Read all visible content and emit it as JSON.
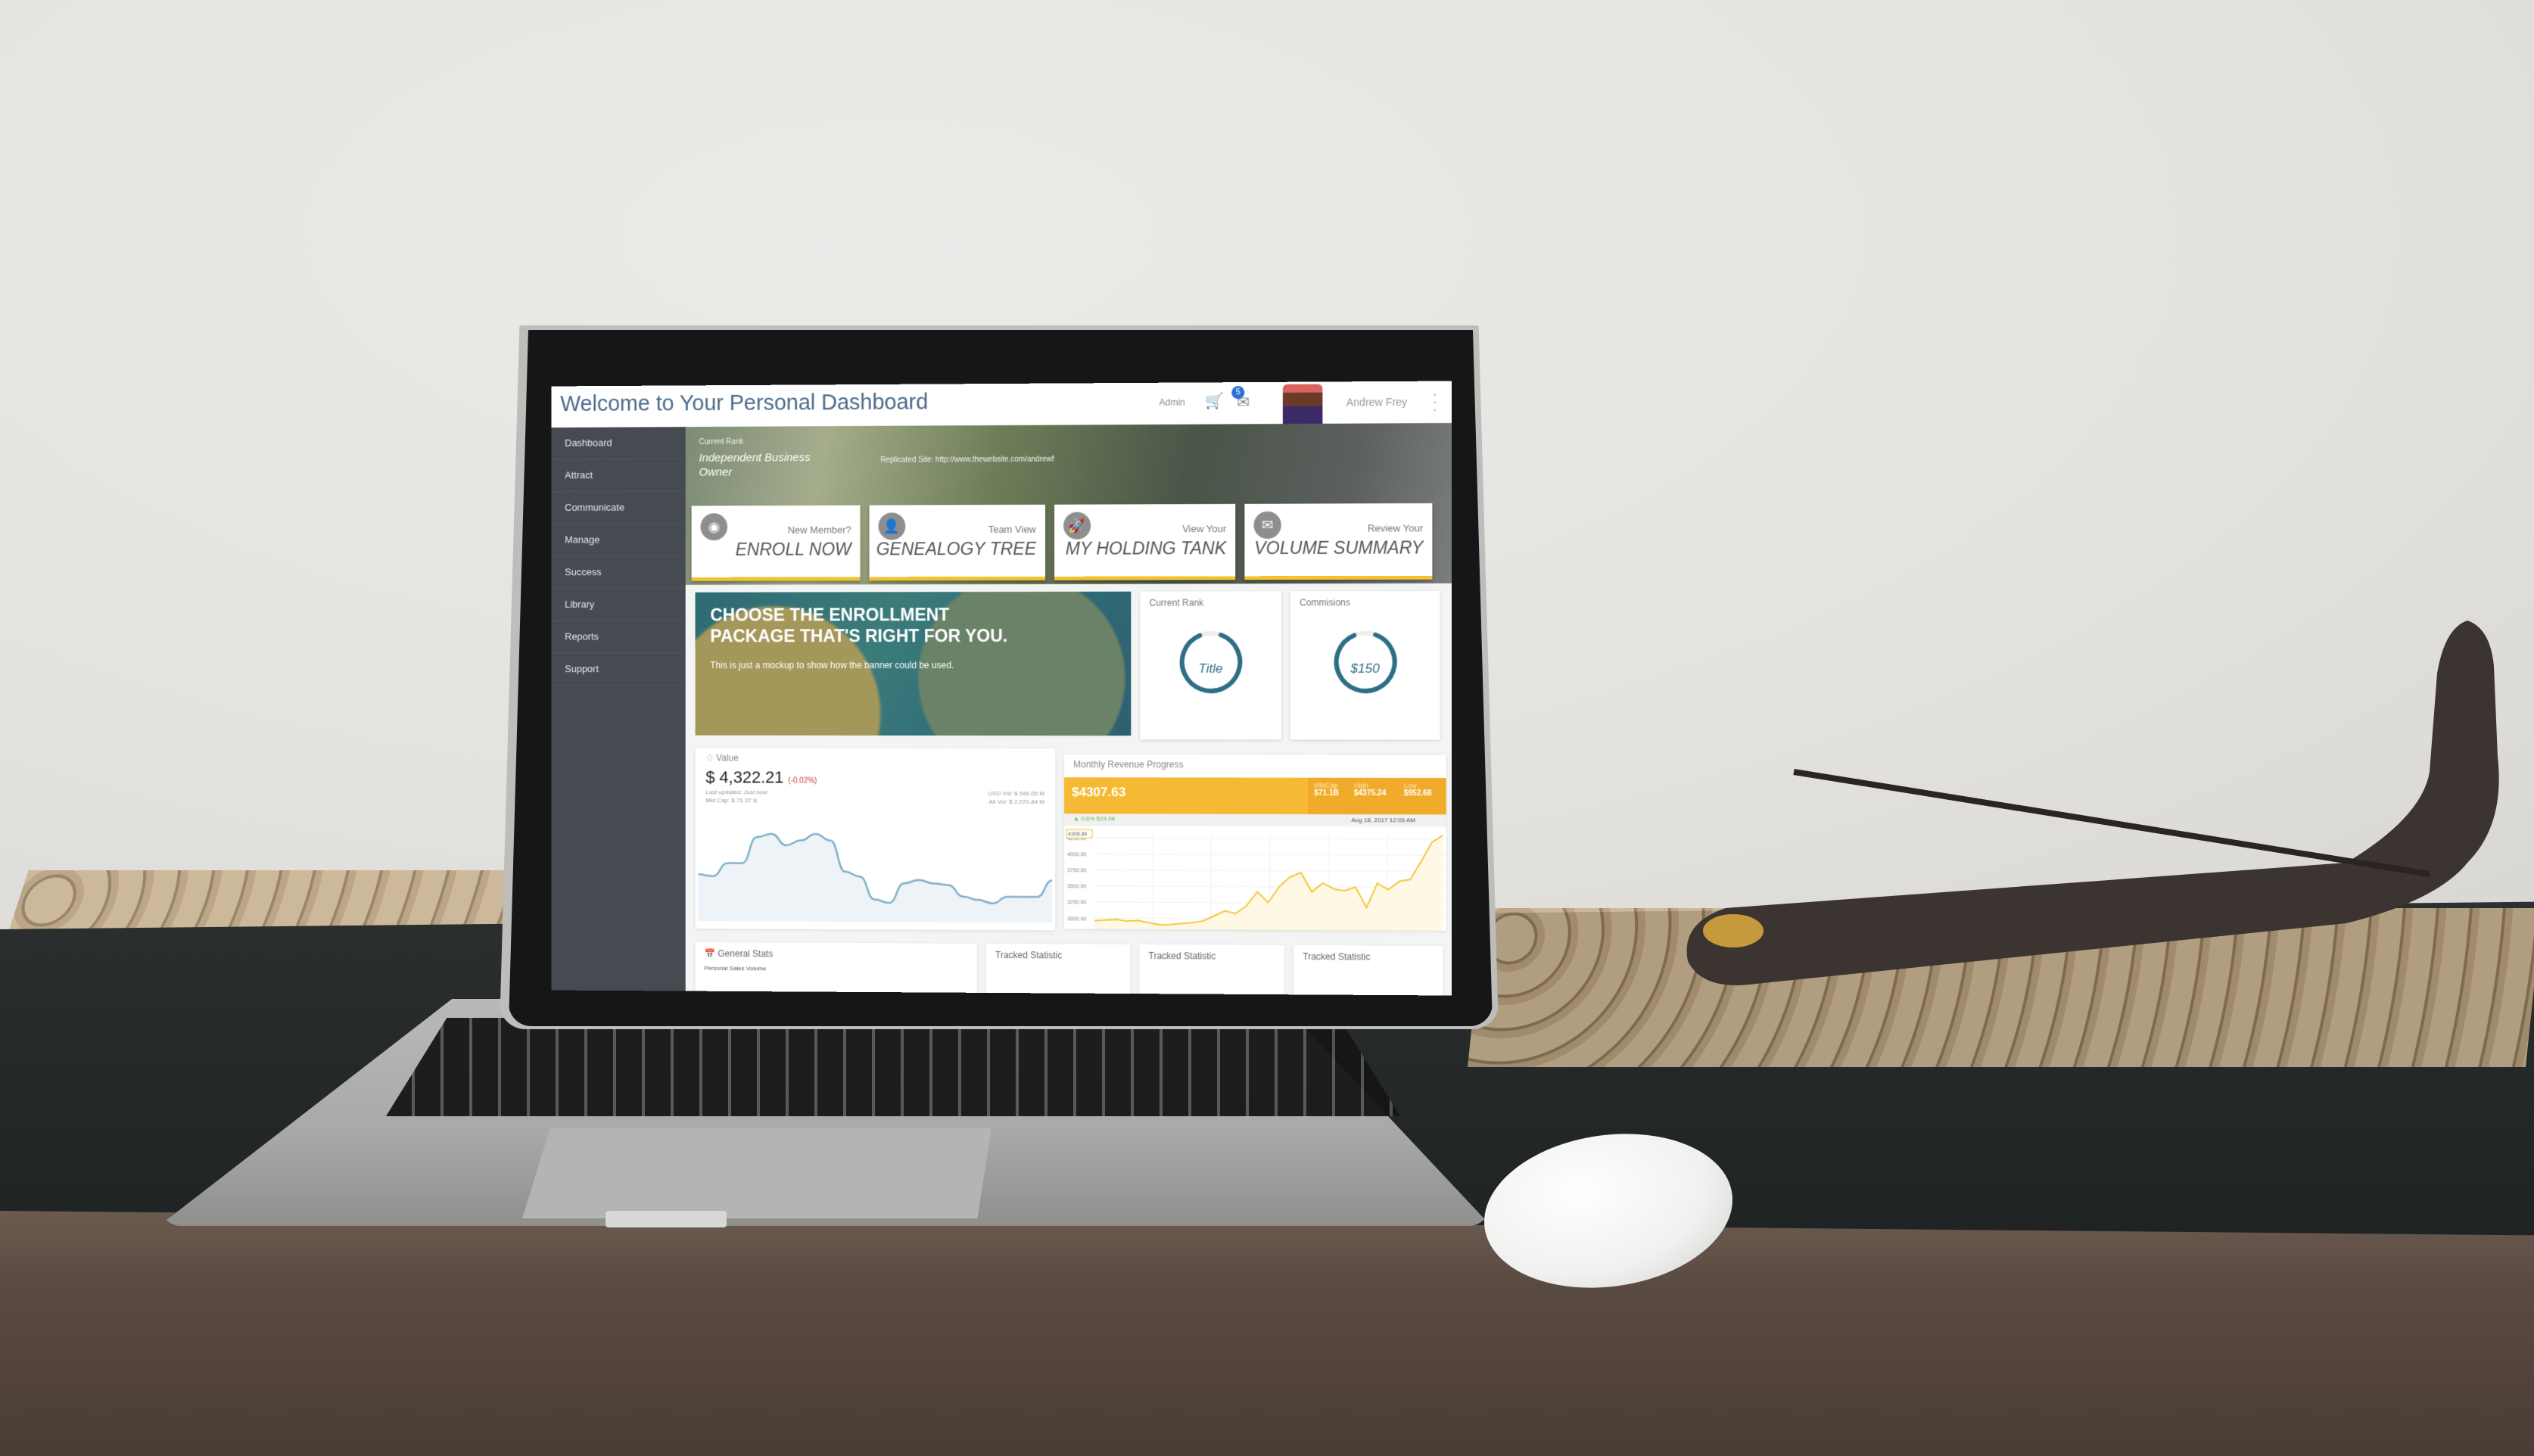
{
  "header": {
    "title": "Welcome to Your Personal Dashboard",
    "admin_label": "Admin",
    "cart_icon": "cart-icon",
    "mail_icon": "mail-icon",
    "notification_count": "5",
    "user_name": "Andrew Frey",
    "more_icon": "vertical-dots-icon"
  },
  "sidebar": {
    "items": [
      {
        "label": "Dashboard"
      },
      {
        "label": "Attract"
      },
      {
        "label": "Communicate"
      },
      {
        "label": "Manage"
      },
      {
        "label": "Success"
      },
      {
        "label": "Library"
      },
      {
        "label": "Reports"
      },
      {
        "label": "Support"
      }
    ]
  },
  "hero": {
    "rank_label": "Current Rank",
    "rank_value": "Independent Business Owner",
    "replicated_site": "Replicated Site: http://www.thewebsite.com/andrewf"
  },
  "actions": [
    {
      "icon": "eye-icon",
      "subtitle": "New Member?",
      "title": "ENROLL NOW"
    },
    {
      "icon": "users-icon",
      "subtitle": "Team View",
      "title": "GENEALOGY TREE"
    },
    {
      "icon": "rocket-icon",
      "subtitle": "View Your",
      "title": "MY HOLDING TANK"
    },
    {
      "icon": "envelope-icon",
      "subtitle": "Review Your",
      "title": "VOLUME SUMMARY"
    }
  ],
  "banner": {
    "headline": "CHOOSE THE ENROLLMENT PACKAGE THAT'S RIGHT FOR YOU.",
    "body": "This is just a mockup to show how the banner could be used."
  },
  "current_rank_card": {
    "label": "Current Rank",
    "value": "Title",
    "progress": 0.88
  },
  "commissions_card": {
    "label": "Commisions",
    "value": "$150",
    "progress": 0.88
  },
  "value_card": {
    "title": "Value",
    "price": "$ 4,322.21",
    "change": "(-0.02%)",
    "last_updated": "Last updated: Just now",
    "mkt_cap": "Mkt Cap: $ 71.37 B",
    "usd_vol": "USD Vol: $ 546.05 M",
    "all_vol": "All Vol: $ 2,070.84 M"
  },
  "revenue_card": {
    "title": "Monthly Revenue Progress",
    "price": "$4307.63",
    "delta": "▲ 0.6% $24.08",
    "mktcap_label": "MktCap",
    "mktcap_value": "$71.1B",
    "high_label": "High",
    "high_value": "$4375.24",
    "low_label": "Low",
    "low_value": "$952.68",
    "date": "Aug 18, 2017 12:05 AM",
    "current_marker": "4308.84"
  },
  "stats": {
    "general_title": "General Stats",
    "general_sub": "Personal Sales Volume",
    "tracked": [
      "Tracked Statistic",
      "Tracked Statistic",
      "Tracked Statistic"
    ]
  },
  "chart_data": [
    {
      "type": "area",
      "title": "Value",
      "x": [
        0,
        1,
        2,
        3,
        4,
        5,
        6,
        7,
        8,
        9,
        10,
        11,
        12,
        13,
        14,
        15,
        16,
        17,
        18,
        19,
        20,
        21,
        22,
        23,
        24
      ],
      "values": [
        45,
        44,
        52,
        52,
        68,
        70,
        63,
        66,
        70,
        66,
        47,
        44,
        30,
        28,
        40,
        42,
        40,
        39,
        32,
        30,
        28,
        32,
        32,
        32,
        42
      ],
      "ylim": [
        20,
        80
      ],
      "xlabel": "",
      "ylabel": ""
    },
    {
      "type": "area",
      "title": "Monthly Revenue Progress",
      "yticks": [
        "3000.00",
        "3250.00",
        "3500.00",
        "3750.00",
        "4000.00",
        "4250.00"
      ],
      "ylim": [
        2900,
        4320
      ],
      "values": [
        2960,
        2970,
        2980,
        2955,
        2965,
        2930,
        2900,
        2905,
        2920,
        2935,
        2960,
        3040,
        3120,
        3080,
        3200,
        3420,
        3250,
        3500,
        3650,
        3720,
        3420,
        3560,
        3470,
        3440,
        3500,
        3180,
        3560,
        3460,
        3590,
        3620,
        3900,
        4200,
        4308.84
      ],
      "xlabel": "",
      "ylabel": ""
    }
  ]
}
